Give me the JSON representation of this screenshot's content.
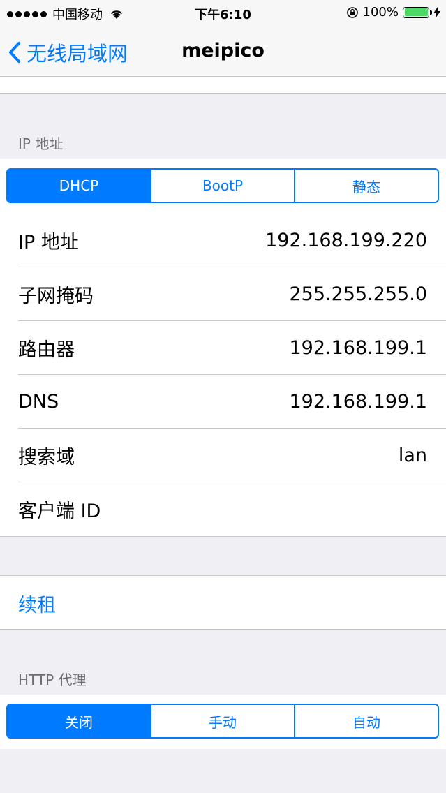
{
  "status_bar": {
    "carrier": "中国移动",
    "time": "下午6:10",
    "battery": "100%",
    "battery_level": 1.0,
    "battery_color": "#4cd964"
  },
  "nav": {
    "back_label": "无线局域网",
    "title": "meipico"
  },
  "ip_section": {
    "header": "IP 地址",
    "segments": [
      "DHCP",
      "BootP",
      "静态"
    ],
    "selected": "DHCP",
    "rows": [
      {
        "label": "IP 地址",
        "value": "192.168.199.220"
      },
      {
        "label": "子网掩码",
        "value": "255.255.255.0"
      },
      {
        "label": "路由器",
        "value": "192.168.199.1"
      },
      {
        "label": "DNS",
        "value": "192.168.199.1"
      },
      {
        "label": "搜索域",
        "value": "lan"
      },
      {
        "label": "客户端 ID",
        "value": ""
      }
    ]
  },
  "renew_label": "续租",
  "proxy_section": {
    "header": "HTTP 代理",
    "segments": [
      "关闭",
      "手动",
      "自动"
    ],
    "selected": "关闭"
  },
  "colors": {
    "accent": "#007aff",
    "background": "#efeff4"
  }
}
